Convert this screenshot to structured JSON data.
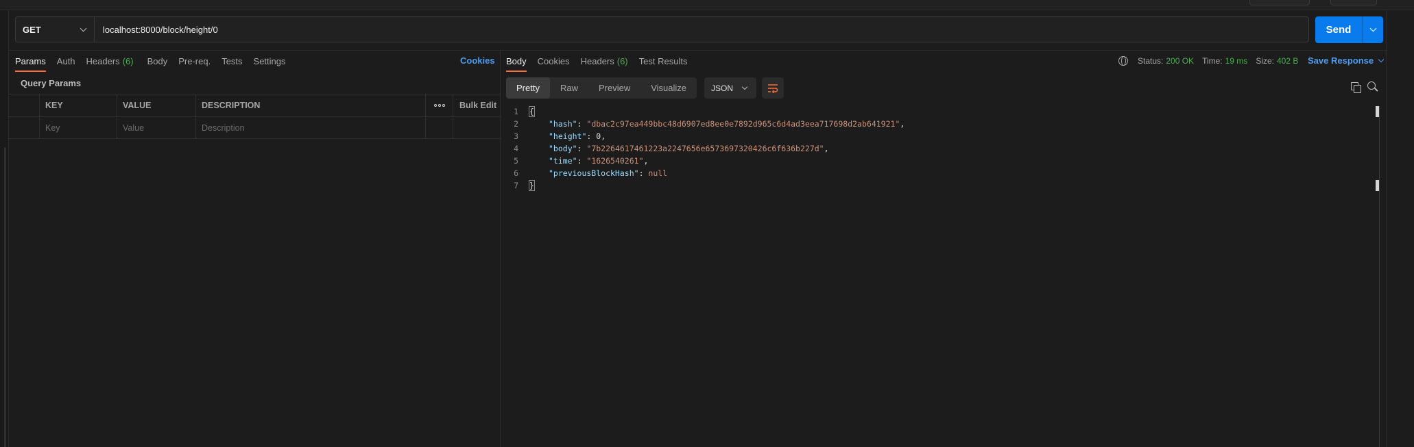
{
  "request": {
    "method": "GET",
    "url": "localhost:8000/block/height/0",
    "send_label": "Send"
  },
  "request_tabs": [
    {
      "label": "Params",
      "active": true
    },
    {
      "label": "Auth"
    },
    {
      "label": "Headers",
      "count": "(6)"
    },
    {
      "label": "Body"
    },
    {
      "label": "Pre-req."
    },
    {
      "label": "Tests"
    },
    {
      "label": "Settings"
    }
  ],
  "cookies_link": "Cookies",
  "params": {
    "title": "Query Params",
    "columns": {
      "key": "KEY",
      "value": "VALUE",
      "description": "DESCRIPTION",
      "bulk_edit": "Bulk Edit"
    },
    "placeholders": {
      "key": "Key",
      "value": "Value",
      "description": "Description"
    }
  },
  "response_tabs": [
    {
      "label": "Body",
      "active": true
    },
    {
      "label": "Cookies"
    },
    {
      "label": "Headers",
      "count": "(6)"
    },
    {
      "label": "Test Results"
    }
  ],
  "status": {
    "status_label": "Status:",
    "status_value": "200 OK",
    "time_label": "Time:",
    "time_value": "19 ms",
    "size_label": "Size:",
    "size_value": "402 B"
  },
  "save_response": "Save Response",
  "view_modes": [
    "Pretty",
    "Raw",
    "Preview",
    "Visualize"
  ],
  "format": "JSON",
  "response_body": {
    "line_numbers": [
      "1",
      "2",
      "3",
      "4",
      "5",
      "6",
      "7"
    ],
    "open": "{",
    "close": "}",
    "fields": [
      {
        "key": "\"hash\"",
        "value": "\"dbac2c97ea449bbc48d6907ed8ee0e7892d965c6d4ad3eea717698d2ab641921\"",
        "type": "string",
        "trail": ","
      },
      {
        "key": "\"height\"",
        "value": "0",
        "type": "number",
        "trail": ","
      },
      {
        "key": "\"body\"",
        "value": "\"7b2264617461223a2247656e6573697320426c6f636b227d\"",
        "type": "string",
        "trail": ","
      },
      {
        "key": "\"time\"",
        "value": "\"1626540261\"",
        "type": "string",
        "trail": ","
      },
      {
        "key": "\"previousBlockHash\"",
        "value": "null",
        "type": "null",
        "trail": ""
      }
    ]
  },
  "colors": {
    "accent_tab": "#ff6c37",
    "send_button": "#097bed",
    "status_ok": "#4caf50",
    "link": "#4d9cf0",
    "json_key": "#9cdcfe",
    "json_string": "#ce9178"
  },
  "icons": [
    "chevron-down-icon",
    "more-icon",
    "globe-icon",
    "wrap-lines-icon",
    "copy-icon",
    "search-icon"
  ]
}
